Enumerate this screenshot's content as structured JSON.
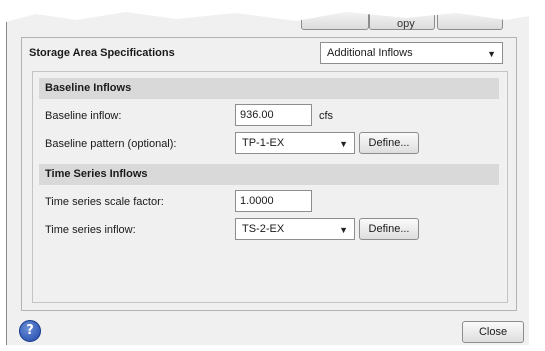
{
  "top": {
    "partial_button_text": "opy"
  },
  "header": {
    "title": "Storage Area Specifications",
    "selector_value": "Additional Inflows"
  },
  "baseline": {
    "section_title": "Baseline Inflows",
    "inflow_label": "Baseline inflow:",
    "inflow_value": "936.00",
    "inflow_unit": "cfs",
    "pattern_label": "Baseline pattern (optional):",
    "pattern_value": "TP-1-EX",
    "define_label": "Define..."
  },
  "timeseries": {
    "section_title": "Time Series Inflows",
    "scale_label": "Time series scale factor:",
    "scale_value": "1.0000",
    "inflow_label": "Time series inflow:",
    "inflow_value": "TS-2-EX",
    "define_label": "Define..."
  },
  "footer": {
    "help_glyph": "?",
    "close_label": "Close"
  }
}
